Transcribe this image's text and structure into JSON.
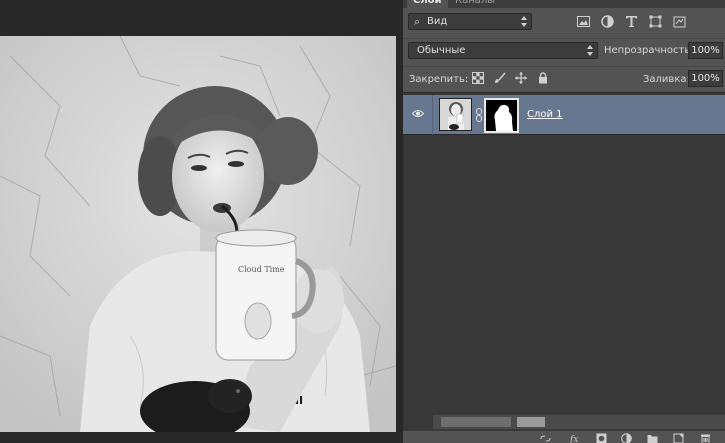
{
  "panel": {
    "tabs": [
      {
        "label": "Слои",
        "active": true
      },
      {
        "label": "Каналы",
        "active": false
      }
    ],
    "filter": {
      "value": "Вид",
      "icons": [
        "image-filter-icon",
        "adjustment-filter-icon",
        "type-filter-icon",
        "shape-filter-icon",
        "smart-object-filter-icon"
      ]
    },
    "blend_mode": "Обычные",
    "opacity_label": "Непрозрачность:",
    "opacity_value": "100%",
    "lock_label": "Закрепить:",
    "lock_icons": [
      "lock-transparent-pixels-icon",
      "lock-image-pixels-icon",
      "lock-position-icon",
      "lock-all-icon"
    ],
    "fill_label": "Заливка:",
    "fill_value": "100%"
  },
  "layers": [
    {
      "name": "Слой 1",
      "visible": true,
      "selected": true,
      "has_mask": true
    }
  ],
  "footer_icons": [
    "link-layers-icon",
    "fx-icon",
    "add-mask-icon",
    "adjustment-layer-icon",
    "new-group-icon",
    "new-layer-icon",
    "trash-icon"
  ],
  "colors": {
    "panel_bg": "#535353",
    "selected_layer": "#677790",
    "canvas_bg": "#282828"
  }
}
